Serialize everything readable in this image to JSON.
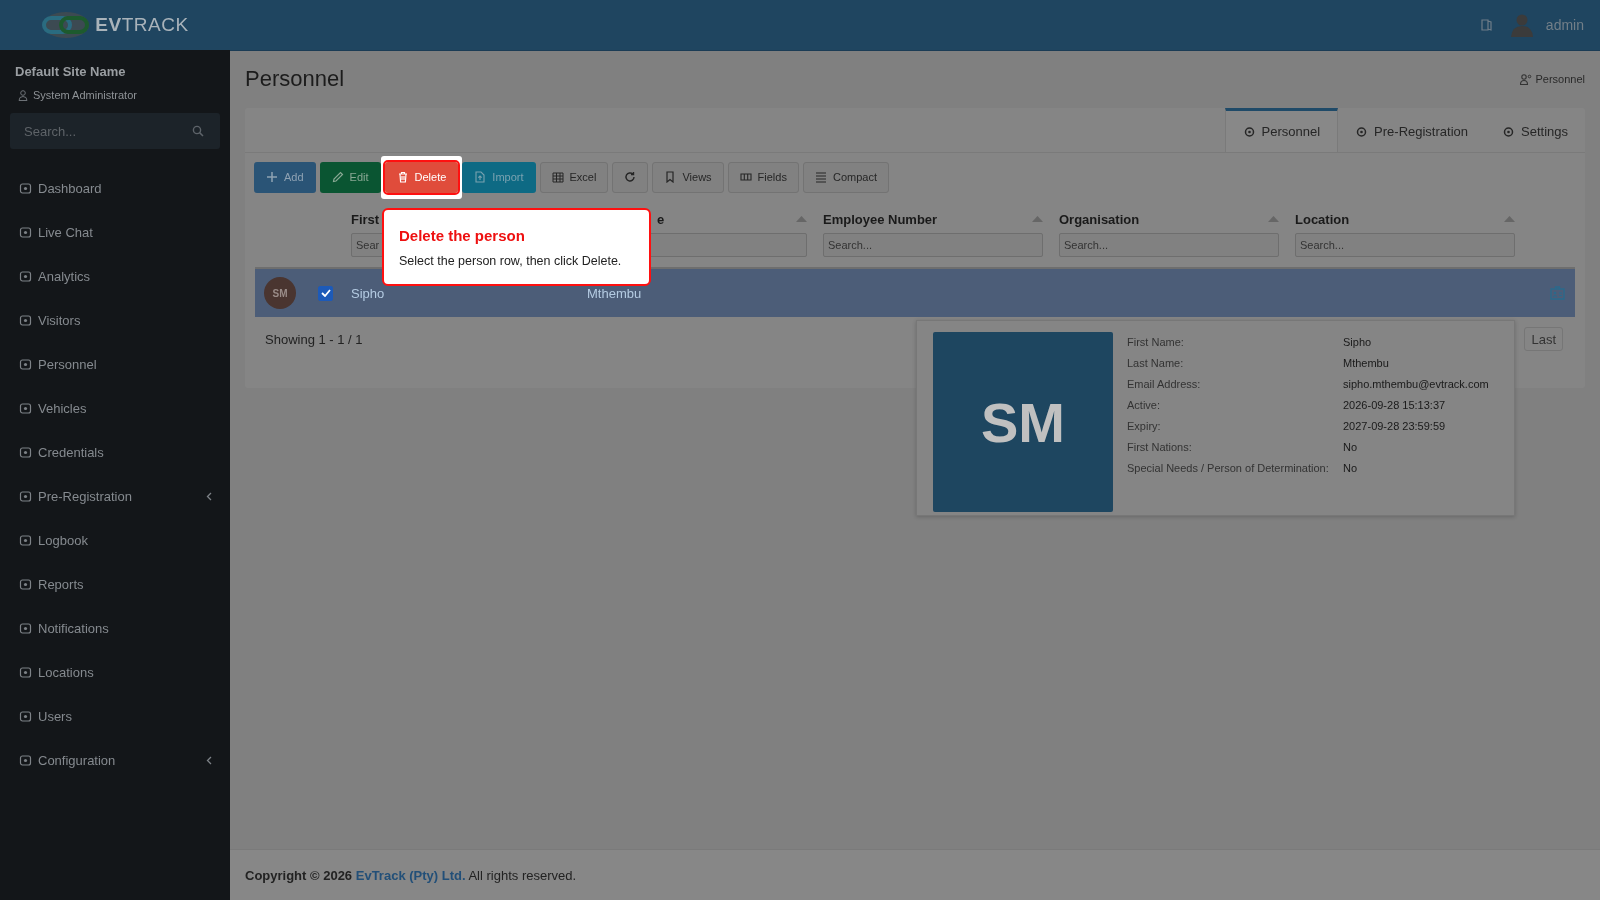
{
  "header": {
    "logo": "**EV**TRACK",
    "user": "admin"
  },
  "sidebar": {
    "site_name": "Default Site Name",
    "role": "System Administrator",
    "search": {
      "placeholder": "Search..."
    },
    "items": [
      {
        "label": "Dashboard",
        "has_submenu": false
      },
      {
        "label": "Live Chat",
        "has_submenu": false
      },
      {
        "label": "Analytics",
        "has_submenu": false
      },
      {
        "label": "Visitors",
        "has_submenu": false
      },
      {
        "label": "Personnel",
        "has_submenu": false
      },
      {
        "label": "Vehicles",
        "has_submenu": false
      },
      {
        "label": "Credentials",
        "has_submenu": false
      },
      {
        "label": "Pre-Registration",
        "has_submenu": true
      },
      {
        "label": "Logbook",
        "has_submenu": false
      },
      {
        "label": "Reports",
        "has_submenu": false
      },
      {
        "label": "Notifications",
        "has_submenu": false
      },
      {
        "label": "Locations",
        "has_submenu": false
      },
      {
        "label": "Users",
        "has_submenu": false
      },
      {
        "label": "Configuration",
        "has_submenu": true
      }
    ]
  },
  "page": {
    "title": "Personnel",
    "breadcrumb": "Personnel"
  },
  "tabs": [
    {
      "label": "Personnel",
      "selected": true
    },
    {
      "label": "Pre-Registration",
      "selected": false
    },
    {
      "label": "Settings",
      "selected": false
    }
  ],
  "toolbar": [
    {
      "kind": "add",
      "label": "Add",
      "highlighted": false
    },
    {
      "kind": "edit",
      "label": "Edit",
      "highlighted": false
    },
    {
      "kind": "delete",
      "label": "Delete",
      "highlighted": true
    },
    {
      "kind": "import",
      "label": "Import",
      "highlighted": false
    },
    {
      "kind": "excel",
      "label": "Excel",
      "highlighted": false
    },
    {
      "kind": "refresh",
      "highlighted": false
    },
    {
      "kind": "views",
      "label": "Views",
      "highlighted": false
    },
    {
      "kind": "fields",
      "label": "Fields",
      "highlighted": false
    },
    {
      "kind": "compact",
      "label": "Compact",
      "highlighted": false
    }
  ],
  "columns": [
    {
      "label": "First",
      "placeholder": "Sear"
    },
    {
      "label": "e",
      "sort_arrow": true
    },
    {
      "label": "Employee Number",
      "placeholder": "Search...",
      "sort_arrow": true
    },
    {
      "label": "Organisation",
      "placeholder": "Search...",
      "sort_arrow": true
    },
    {
      "label": "Location",
      "placeholder": "Search...",
      "sort_arrow": true
    }
  ],
  "rows": [
    {
      "initials": "SM",
      "checked": true,
      "selected": true,
      "first_name": "Sipho",
      "last_name": "Mthembu"
    }
  ],
  "showing": "Showing 1 - 1 / 1",
  "pagination": [
    "Last"
  ],
  "tour": {
    "title": "Delete the person",
    "text": "Select the person row, then click Delete."
  },
  "preview": {
    "initials": "SM",
    "fields": [
      {
        "label": "First Name:",
        "value": "Sipho"
      },
      {
        "label": "Last Name:",
        "value": "Mthembu"
      },
      {
        "label": "Email Address:",
        "value": "sipho.mthembu@evtrack.com"
      },
      {
        "label": "Active:",
        "value": "2026-09-28 15:13:37"
      },
      {
        "label": "Expiry:",
        "value": "2027-09-28 23:59:59"
      },
      {
        "label": "First Nations:",
        "value": "No"
      },
      {
        "label": "Special Needs / Person of Determination:",
        "value": "No"
      }
    ]
  },
  "footer": {
    "prefix": "Copyright © 2026",
    "link": "EvTrack (Pty) Ltd.",
    "suffix": "All rights reserved."
  }
}
